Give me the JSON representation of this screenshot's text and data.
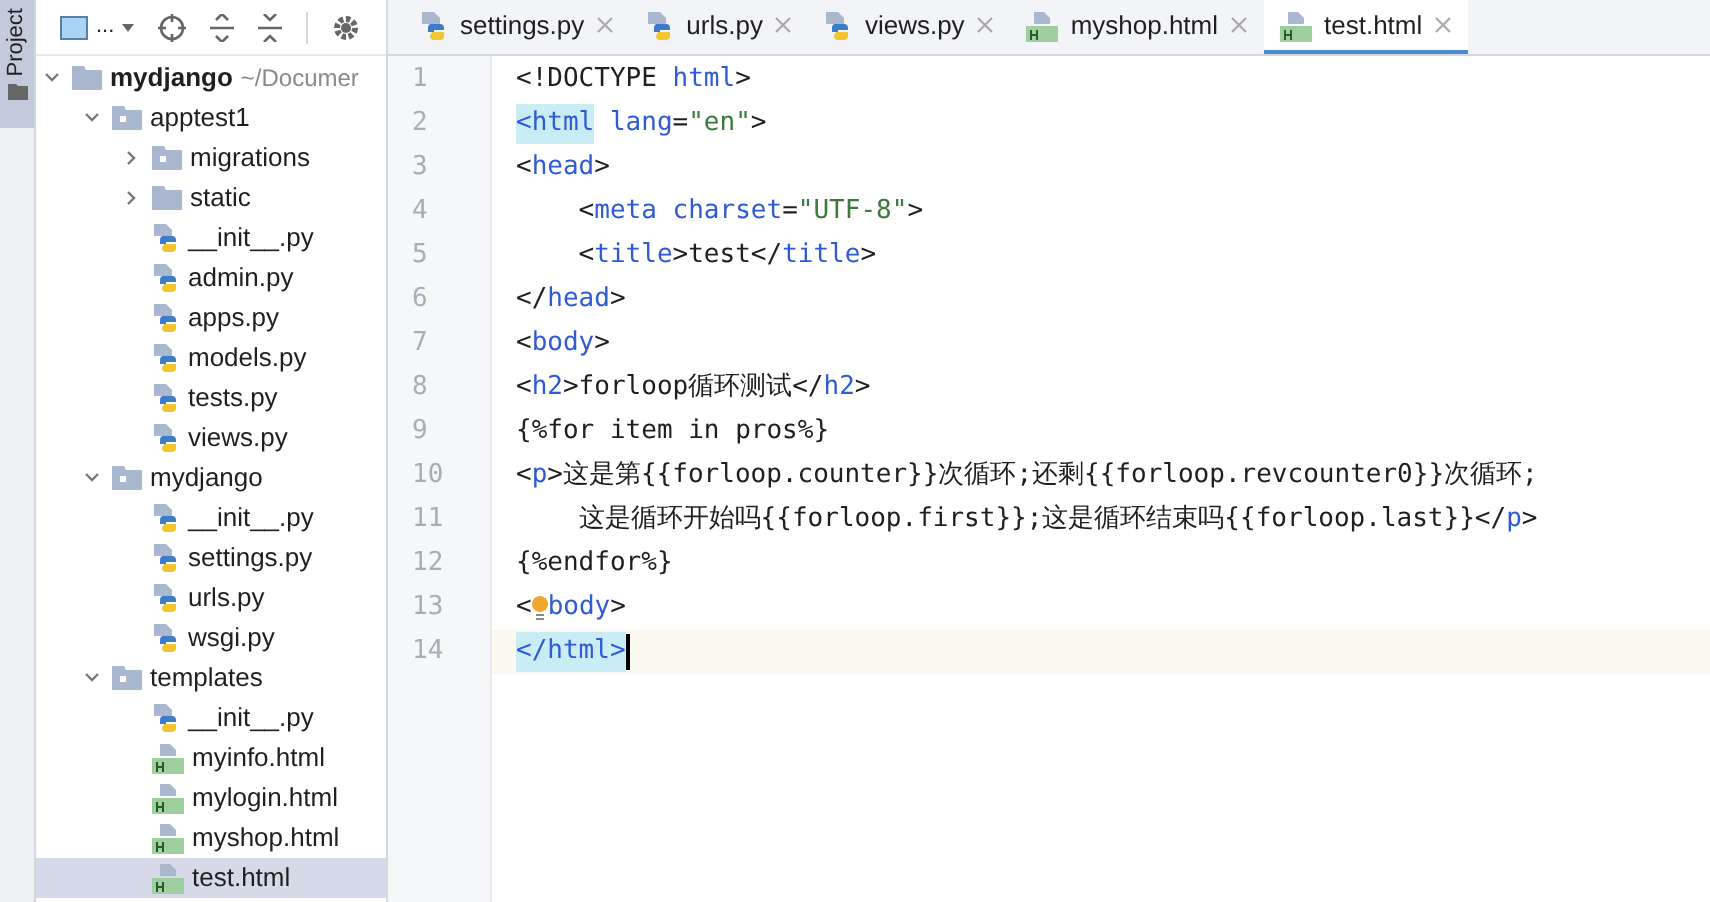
{
  "side_tab": {
    "label": "Project",
    "selected": true
  },
  "toolbar": {
    "view_label": "..."
  },
  "tree": [
    {
      "name": "mydjango",
      "hint": "~/Documer",
      "kind": "folder",
      "expanded": true,
      "selected": false,
      "children": [
        {
          "name": "apptest1",
          "kind": "module",
          "expanded": true,
          "selected": false,
          "children": [
            {
              "name": "migrations",
              "kind": "module",
              "expanded": false,
              "selected": false
            },
            {
              "name": "static",
              "kind": "folder",
              "expanded": false,
              "selected": false
            },
            {
              "name": "__init__.py",
              "kind": "py",
              "selected": false
            },
            {
              "name": "admin.py",
              "kind": "py",
              "selected": false
            },
            {
              "name": "apps.py",
              "kind": "py",
              "selected": false
            },
            {
              "name": "models.py",
              "kind": "py",
              "selected": false
            },
            {
              "name": "tests.py",
              "kind": "py",
              "selected": false
            },
            {
              "name": "views.py",
              "kind": "py",
              "selected": false
            }
          ]
        },
        {
          "name": "mydjango",
          "kind": "module",
          "expanded": true,
          "selected": false,
          "children": [
            {
              "name": "__init__.py",
              "kind": "py",
              "selected": false
            },
            {
              "name": "settings.py",
              "kind": "py",
              "selected": false
            },
            {
              "name": "urls.py",
              "kind": "py",
              "selected": false
            },
            {
              "name": "wsgi.py",
              "kind": "py",
              "selected": false
            }
          ]
        },
        {
          "name": "templates",
          "kind": "module",
          "expanded": true,
          "selected": false,
          "children": [
            {
              "name": "__init__.py",
              "kind": "py",
              "selected": false
            },
            {
              "name": "myinfo.html",
              "kind": "html",
              "selected": false
            },
            {
              "name": "mylogin.html",
              "kind": "html",
              "selected": false
            },
            {
              "name": "myshop.html",
              "kind": "html",
              "selected": false
            },
            {
              "name": "test.html",
              "kind": "html",
              "selected": true
            }
          ]
        }
      ]
    }
  ],
  "tabs": [
    {
      "label": "settings.py",
      "kind": "py",
      "selected": false
    },
    {
      "label": "urls.py",
      "kind": "py",
      "selected": false
    },
    {
      "label": "views.py",
      "kind": "py",
      "selected": false
    },
    {
      "label": "myshop.html",
      "kind": "html",
      "selected": false
    },
    {
      "label": "test.html",
      "kind": "html",
      "selected": true
    }
  ],
  "editor": {
    "lines": [
      {
        "number": "1",
        "current": false,
        "segments": [
          {
            "kind": "text",
            "text": "<!DOCTYPE "
          },
          {
            "kind": "tag",
            "text": "html"
          },
          {
            "kind": "text",
            "text": ">"
          }
        ]
      },
      {
        "number": "2",
        "current": false,
        "segments": [
          {
            "kind": "match",
            "text": "<html"
          },
          {
            "kind": "tag",
            "text": " lang"
          },
          {
            "kind": "text",
            "text": "="
          },
          {
            "kind": "string",
            "text": "\"en\""
          },
          {
            "kind": "text",
            "text": ">"
          }
        ]
      },
      {
        "number": "3",
        "current": false,
        "segments": [
          {
            "kind": "text",
            "text": "<"
          },
          {
            "kind": "tag",
            "text": "head"
          },
          {
            "kind": "text",
            "text": ">"
          }
        ]
      },
      {
        "number": "4",
        "current": false,
        "segments": [
          {
            "kind": "text",
            "text": "    <"
          },
          {
            "kind": "tag",
            "text": "meta charset"
          },
          {
            "kind": "text",
            "text": "="
          },
          {
            "kind": "string",
            "text": "\"UTF-8\""
          },
          {
            "kind": "text",
            "text": ">"
          }
        ]
      },
      {
        "number": "5",
        "current": false,
        "segments": [
          {
            "kind": "text",
            "text": "    <"
          },
          {
            "kind": "tag",
            "text": "title"
          },
          {
            "kind": "text",
            "text": ">test</"
          },
          {
            "kind": "tag",
            "text": "title"
          },
          {
            "kind": "text",
            "text": ">"
          }
        ]
      },
      {
        "number": "6",
        "current": false,
        "segments": [
          {
            "kind": "text",
            "text": "</"
          },
          {
            "kind": "tag",
            "text": "head"
          },
          {
            "kind": "text",
            "text": ">"
          }
        ]
      },
      {
        "number": "7",
        "current": false,
        "segments": [
          {
            "kind": "text",
            "text": "<"
          },
          {
            "kind": "tag",
            "text": "body"
          },
          {
            "kind": "text",
            "text": ">"
          }
        ]
      },
      {
        "number": "8",
        "current": false,
        "segments": [
          {
            "kind": "text",
            "text": "<"
          },
          {
            "kind": "tag",
            "text": "h2"
          },
          {
            "kind": "text",
            "text": ">forloop循环测试</"
          },
          {
            "kind": "tag",
            "text": "h2"
          },
          {
            "kind": "text",
            "text": ">"
          }
        ]
      },
      {
        "number": "9",
        "current": false,
        "segments": [
          {
            "kind": "text",
            "text": "{%for item in pros%}"
          }
        ]
      },
      {
        "number": "10",
        "current": false,
        "segments": [
          {
            "kind": "text",
            "text": "<"
          },
          {
            "kind": "tag",
            "text": "p"
          },
          {
            "kind": "text",
            "text": ">这是第{{forloop.counter}}次循环;还剩{{forloop.revcounter0}}次循环;"
          }
        ]
      },
      {
        "number": "11",
        "current": false,
        "segments": [
          {
            "kind": "text",
            "text": "    这是循环开始吗{{forloop.first}};这是循环结束吗{{forloop.last}}</"
          },
          {
            "kind": "tag",
            "text": "p"
          },
          {
            "kind": "text",
            "text": ">"
          }
        ]
      },
      {
        "number": "12",
        "current": false,
        "segments": [
          {
            "kind": "text",
            "text": "{%endfor%}"
          }
        ]
      },
      {
        "number": "13",
        "current": false,
        "segments": [
          {
            "kind": "text",
            "text": "<"
          },
          {
            "kind": "bulb"
          },
          {
            "kind": "tag",
            "text": "body"
          },
          {
            "kind": "text",
            "text": ">"
          }
        ]
      },
      {
        "number": "14",
        "current": true,
        "segments": [
          {
            "kind": "match",
            "text": "</html>"
          },
          {
            "kind": "cursor"
          }
        ]
      }
    ]
  }
}
